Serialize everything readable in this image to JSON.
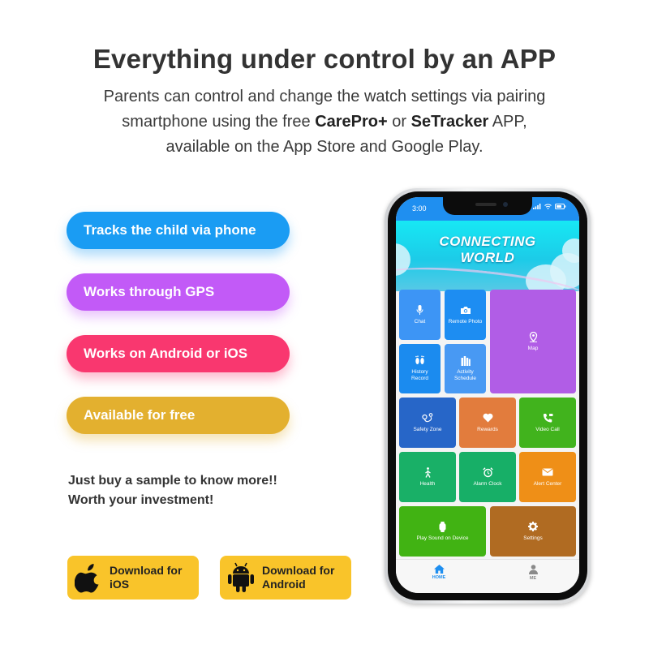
{
  "header": {
    "title": "Everything under control by an APP",
    "line1": "Parents can control and change the watch settings via pairing",
    "line2_pre": "smartphone using the free ",
    "line2_app1": "CarePro+",
    "line2_mid": " or ",
    "line2_app2": "SeTracker",
    "line2_post": " APP,",
    "line3": "available on the App Store and Google Play."
  },
  "features": [
    {
      "label": "Tracks the child via phone",
      "color": "#1a9cf3"
    },
    {
      "label": "Works through GPS",
      "color": "#c25af7"
    },
    {
      "label": "Works on Android or iOS",
      "color": "#f9376f"
    },
    {
      "label": "Available for free",
      "color": "#e3b02f"
    }
  ],
  "cta": {
    "line1": "Just buy a sample to know more!!",
    "line2": "Worth your investment!"
  },
  "downloads": {
    "ios": {
      "line1": "Download for",
      "line2": "iOS",
      "icon": "apple-icon"
    },
    "android": {
      "line1": "Download for",
      "line2": "Android",
      "icon": "android-icon"
    },
    "color": "#f9c42a"
  },
  "phone": {
    "status_time": "3:00",
    "banner_line1": "CONNECTING",
    "banner_line2": "WORLD",
    "tiles": [
      {
        "label": "Chat",
        "icon": "microphone-icon",
        "color": "#3d95f5"
      },
      {
        "label": "Remote Photo",
        "icon": "camera-icon",
        "color": "#1d8df2"
      },
      {
        "label": "Map",
        "icon": "map-pin-icon",
        "color": "#b15de6"
      },
      {
        "label_1": "History",
        "label_2": "Record",
        "icon": "footprints-icon",
        "color": "#1b8bef"
      },
      {
        "label_1": "Activity",
        "label_2": "Schedule",
        "icon": "books-icon",
        "color": "#4899f3"
      },
      {
        "label": "Safety Zone",
        "icon": "route-icon",
        "color": "#2766c8"
      },
      {
        "label": "Rewards",
        "icon": "heart-icon",
        "color": "#e27c3d"
      },
      {
        "label": "Video Call",
        "icon": "video-call-icon",
        "color": "#41b31d"
      },
      {
        "label": "Health",
        "icon": "walking-icon",
        "color": "#19b067"
      },
      {
        "label": "Alarm Clock",
        "icon": "alarm-clock-icon",
        "color": "#17af67"
      },
      {
        "label": "Alert Center",
        "icon": "envelope-icon",
        "color": "#ef8f17"
      },
      {
        "label": "Play Sound on Device",
        "icon": "watch-icon",
        "color": "#41b313"
      },
      {
        "label": "Settings",
        "icon": "gear-icon",
        "color": "#b06b22"
      }
    ],
    "tabs": [
      {
        "label": "HOME",
        "icon": "home-icon",
        "active": true
      },
      {
        "label": "ME",
        "icon": "person-icon",
        "active": false
      }
    ]
  }
}
